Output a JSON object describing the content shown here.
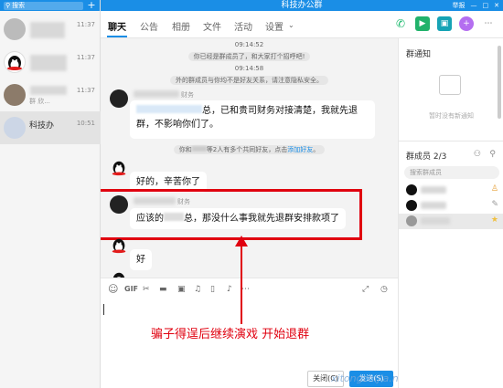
{
  "left": {
    "search_label": "搜索",
    "conversations": [
      {
        "time": "11:37"
      },
      {
        "time": "11:37"
      },
      {
        "time": "11:37",
        "sub": "群 欣..."
      },
      {
        "name": "科技办",
        "time": "10:51"
      }
    ]
  },
  "window": {
    "title": "科技办公群",
    "actions": [
      "举报",
      "—",
      "□",
      "✕"
    ]
  },
  "tabs": [
    "聊天",
    "公告",
    "相册",
    "文件",
    "活动",
    "设置"
  ],
  "chat": {
    "time1": "09:14:52",
    "sys1": "你已经是群成员了，和大家打个招呼吧!",
    "time2": "09:14:58",
    "sys2": "外的群成员与你均不是好友关系，请注意隐私安全。",
    "msg1_role": "财务",
    "msg1_line1": "总，已和贵司财务对接清楚，我就先退",
    "msg1_line2": "群，不影响你们了。",
    "sys3_a": "你和",
    "sys3_b": "等2人有多个共同好友，点击",
    "sys3_link": "添加好友",
    "sys3_c": "。",
    "msg2_text": "好的，辛苦你了",
    "msg3_role": "财务",
    "msg3_a": "应该的",
    "msg3_b": "总，那没什么事我就先退群安排款项了",
    "msg4_text": "好"
  },
  "input": {
    "caption": "骗子得逞后继续演戏 开始退群",
    "close_label": "关闭(C)",
    "send_label": "发送(S)",
    "watermark": "xitongzhijia.net"
  },
  "right": {
    "notice_title": "群通知",
    "notice_empty": "暂时没有新通知",
    "members_title": "群成员 2/3",
    "member_search_placeholder": "搜索群成员"
  },
  "colors": {
    "accent": "#1a8ee6",
    "highlight": "#e0000f"
  }
}
